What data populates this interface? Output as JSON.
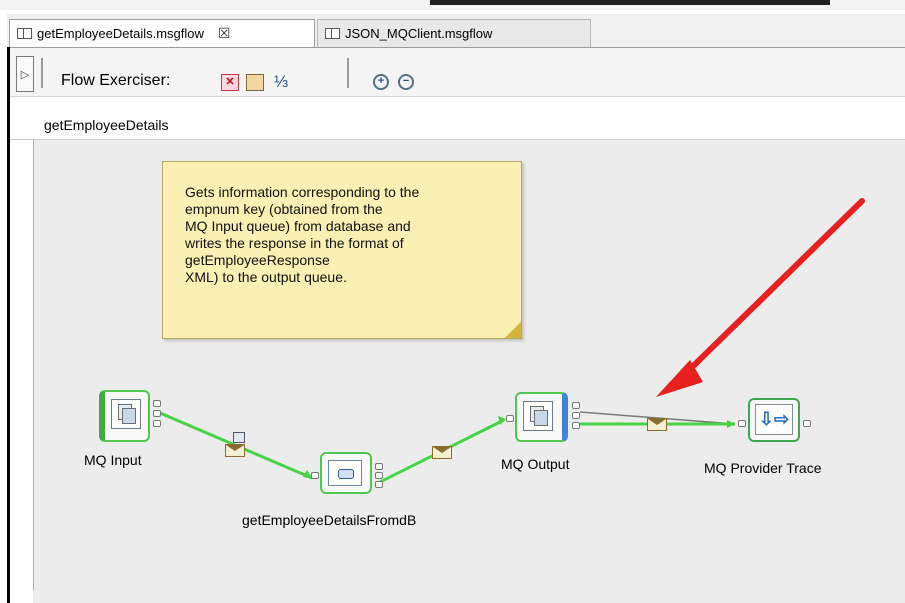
{
  "tabs": [
    {
      "label": "getEmployeeDetails.msgflow",
      "close": "☒",
      "active": true
    },
    {
      "label": "JSON_MQClient.msgflow",
      "active": false
    }
  ],
  "toolbar": {
    "flow_exerciser_label": "Flow Exerciser:",
    "icons": [
      "stop-recording-icon",
      "record-message-icon",
      "view-path-icon",
      "zoom-in-icon",
      "zoom-out-icon"
    ],
    "expander": "▷"
  },
  "breadcrumb": {
    "flow_name": "getEmployeeDetails"
  },
  "note": {
    "text": "Gets information corresponding to the\nempnum key (obtained from the\nMQ Input queue) from database and\nwrites the response in the format of\ngetEmployeeResponse\nXML) to the output queue."
  },
  "nodes": {
    "mq_input": {
      "label": "MQ Input"
    },
    "compute": {
      "label": "getEmployeeDetailsFromdB"
    },
    "mq_output": {
      "label": "MQ Output"
    },
    "trace": {
      "label": "MQ Provider Trace"
    }
  },
  "colors": {
    "connection": "#44d444",
    "selection": "#4fc84f",
    "arrow": "#e8201e",
    "note_fill": "#fbf0b3",
    "canvas": "#ececec"
  }
}
